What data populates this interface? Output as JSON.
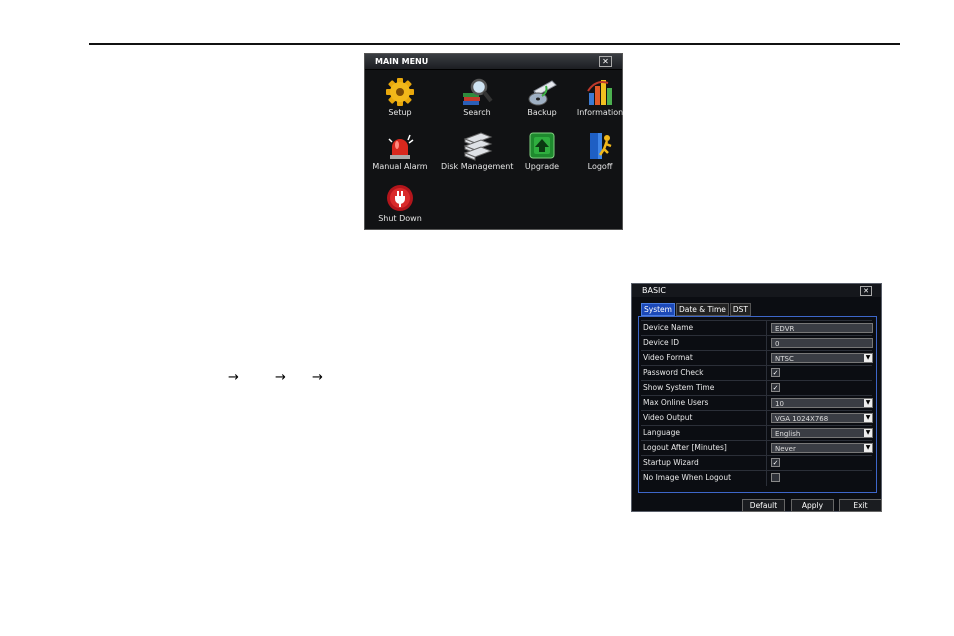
{
  "arrows": [
    "→",
    "→",
    "→"
  ],
  "main_menu": {
    "title": "MAIN MENU",
    "close_label": "✕",
    "items": [
      {
        "label": "Setup",
        "icon": "gear-icon"
      },
      {
        "label": "Search",
        "icon": "magnifier-icon"
      },
      {
        "label": "Backup",
        "icon": "disc-backup-icon"
      },
      {
        "label": "Information",
        "icon": "bar-chart-icon"
      },
      {
        "label": "Manual Alarm",
        "icon": "alarm-siren-icon"
      },
      {
        "label": "Disk Management",
        "icon": "hard-disk-icon"
      },
      {
        "label": "Upgrade",
        "icon": "upgrade-arrow-icon"
      },
      {
        "label": "Logoff",
        "icon": "logoff-door-icon"
      },
      {
        "label": "Shut Down",
        "icon": "power-plug-icon"
      }
    ]
  },
  "basic": {
    "title": "BASIC",
    "close_label": "✕",
    "tabs": [
      "System",
      "Date & Time",
      "DST"
    ],
    "rows": [
      {
        "label": "Device Name",
        "type": "text",
        "value": "EDVR"
      },
      {
        "label": "Device ID",
        "type": "text",
        "value": "0"
      },
      {
        "label": "Video Format",
        "type": "select",
        "value": "NTSC"
      },
      {
        "label": "Password Check",
        "type": "check",
        "checked": true
      },
      {
        "label": "Show System Time",
        "type": "check",
        "checked": true
      },
      {
        "label": "Max Online Users",
        "type": "select",
        "value": "10"
      },
      {
        "label": "Video Output",
        "type": "select",
        "value": "VGA 1024X768"
      },
      {
        "label": "Language",
        "type": "select",
        "value": "English"
      },
      {
        "label": "Logout After [Minutes]",
        "type": "select",
        "value": "Never"
      },
      {
        "label": "Startup Wizard",
        "type": "check",
        "checked": true
      },
      {
        "label": "No Image When Logout",
        "type": "check",
        "checked": false
      }
    ],
    "buttons": {
      "default": "Default",
      "apply": "Apply",
      "exit": "Exit"
    },
    "check_mark": "✓",
    "dropdown_glyph": "▼"
  }
}
